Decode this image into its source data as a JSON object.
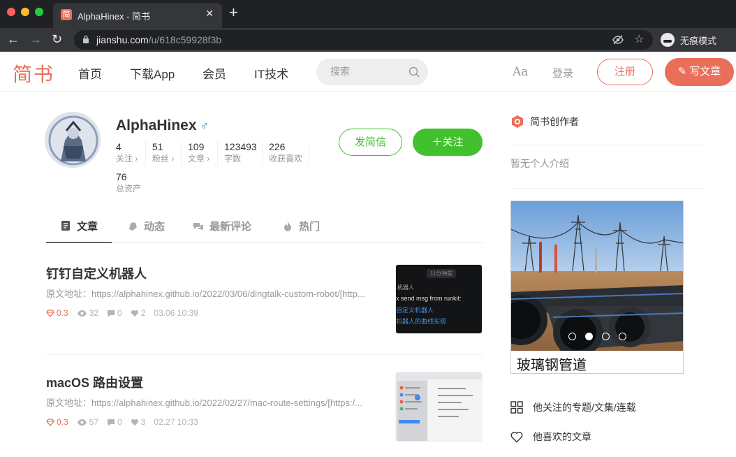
{
  "browser": {
    "tab_title": "AlphaHinex - 简书",
    "tab_favicon": "简",
    "url_host": "jianshu.com",
    "url_path": "/u/618c59928f3b",
    "incognito_label": "无痕模式"
  },
  "header": {
    "logo": "简书",
    "nav": [
      "首页",
      "下载App",
      "会员",
      "IT技术"
    ],
    "search_placeholder": "搜索",
    "font_toggle": "Aa",
    "login": "登录",
    "signup": "注册",
    "write": "写文章"
  },
  "profile": {
    "username": "AlphaHinex",
    "gender_symbol": "♂",
    "stats": [
      {
        "num": "4",
        "label": "关注 ›"
      },
      {
        "num": "51",
        "label": "粉丝 ›"
      },
      {
        "num": "109",
        "label": "文章 ›"
      },
      {
        "num": "123493",
        "label": "字数"
      },
      {
        "num": "226",
        "label": "收获喜欢"
      },
      {
        "num": "76",
        "label": "总资产"
      }
    ],
    "message_button": "发简信",
    "follow_button": "＋关注"
  },
  "tabs": [
    "文章",
    "动态",
    "最新评论",
    "热门"
  ],
  "articles": [
    {
      "title": "钉钉自定义机器人",
      "abstract": "原文地址：https://alphahinex.github.io/2022/03/06/dingtalk-custom-robot/[http...",
      "diamond": "0.3",
      "views": "32",
      "comments": "0",
      "likes": "2",
      "time": "03.06 10:39",
      "thumb_lines": [
        "11分钟前",
        "机器人",
        "x send msg from runkit:",
        "自定义机器人",
        "机器人的曲线实现"
      ]
    },
    {
      "title": "macOS 路由设置",
      "abstract": "原文地址：https://alphahinex.github.io/2022/02/27/mac-route-settings/[https:/...",
      "diamond": "0.3",
      "views": "57",
      "comments": "0",
      "likes": "3",
      "time": "02.27 10:33"
    }
  ],
  "sidebar": {
    "creator_badge": "简书创作者",
    "intro": "暂无个人介绍",
    "banner_caption": "玻璃钢管道",
    "links": [
      "他关注的专题/文集/连载",
      "他喜欢的文章"
    ]
  },
  "colors": {
    "brand": "#ea6f5a",
    "follow_green": "#42c02e"
  }
}
